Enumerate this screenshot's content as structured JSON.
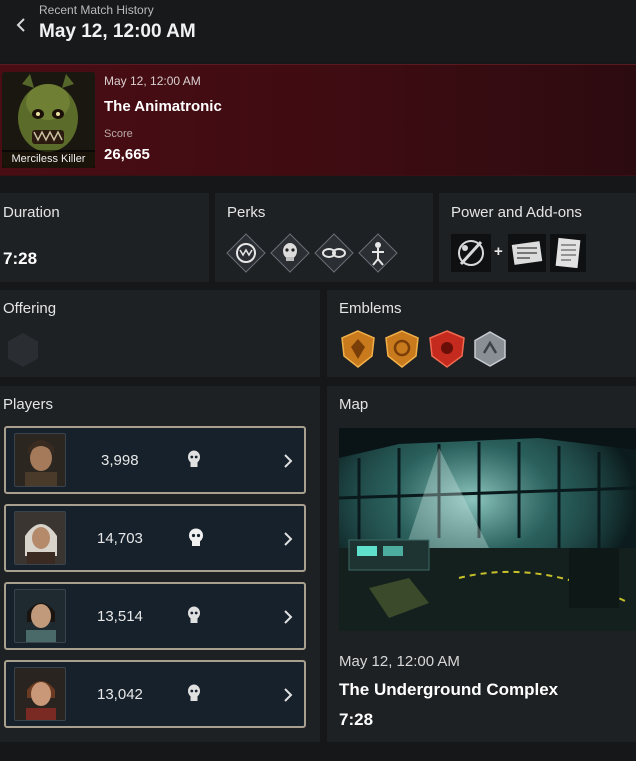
{
  "header": {
    "subtitle": "Recent Match History",
    "title": "May 12, 12:00 AM"
  },
  "hero": {
    "date": "May 12, 12:00 AM",
    "character": "The Animatronic",
    "score_label": "Score",
    "score": "26,665",
    "rank_tag": "Merciless Killer"
  },
  "duration": {
    "label": "Duration",
    "value": "7:28"
  },
  "perks": {
    "label": "Perks",
    "icons": [
      "perk-jaws-icon",
      "perk-skull-icon",
      "perk-chain-icon",
      "perk-figure-icon"
    ]
  },
  "power": {
    "label": "Power and Add-ons",
    "plus": "+"
  },
  "offering": {
    "label": "Offering"
  },
  "emblems": {
    "label": "Emblems",
    "items": [
      {
        "name": "gatekeeper-emblem",
        "color": "#c97a1c"
      },
      {
        "name": "devout-emblem",
        "color": "#c97a1c"
      },
      {
        "name": "malicious-emblem",
        "color": "#c42a1e"
      },
      {
        "name": "chaser-emblem",
        "color": "#8a8f96"
      }
    ]
  },
  "players": {
    "label": "Players",
    "rows": [
      {
        "score": "3,998"
      },
      {
        "score": "14,703"
      },
      {
        "score": "13,514"
      },
      {
        "score": "13,042"
      }
    ]
  },
  "map": {
    "label": "Map",
    "date": "May 12, 12:00 AM",
    "name": "The Underground Complex",
    "duration": "7:28"
  },
  "colors": {
    "hero_bg": "#4a0d14",
    "panel_bg": "#1e2124",
    "card_border": "#a89f8f"
  }
}
